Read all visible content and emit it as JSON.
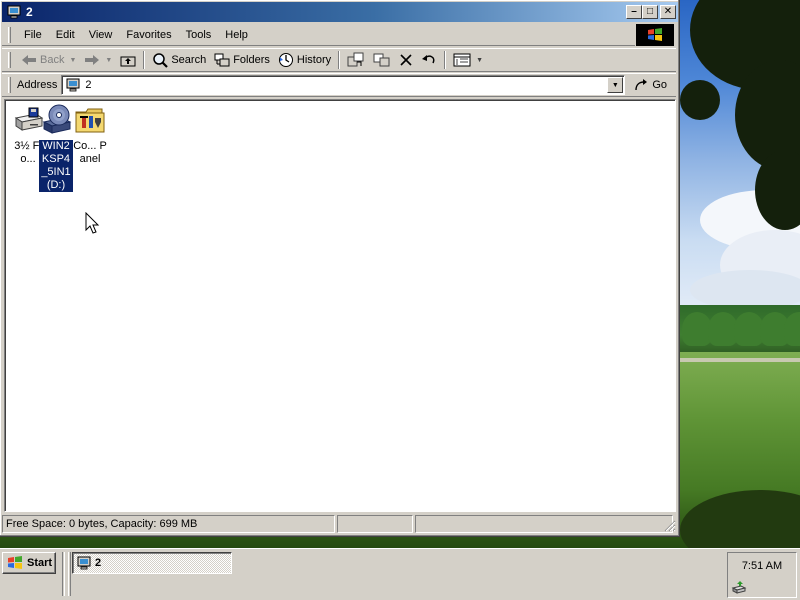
{
  "window": {
    "title": "2",
    "minimize_glyph": "–",
    "maximize_glyph": "□",
    "close_glyph": "✕"
  },
  "menubar": {
    "items": [
      {
        "label": "File"
      },
      {
        "label": "Edit"
      },
      {
        "label": "View"
      },
      {
        "label": "Favorites"
      },
      {
        "label": "Tools"
      },
      {
        "label": "Help"
      }
    ]
  },
  "toolbar": {
    "back_label": "Back",
    "search_label": "Search",
    "folders_label": "Folders",
    "history_label": "History"
  },
  "address": {
    "label": "Address",
    "value": "2",
    "go_label": "Go"
  },
  "files": [
    {
      "label": "3½ Flo...",
      "icon": "floppy-drive-icon",
      "selected": false
    },
    {
      "label": "WIN2KSP4_5IN1 (D:)",
      "icon": "cd-drive-icon",
      "selected": true
    },
    {
      "label": "Co... Panel",
      "icon": "control-panel-icon",
      "selected": false
    }
  ],
  "statusbar": {
    "text": "Free Space: 0 bytes, Capacity: 699 MB"
  },
  "taskbar": {
    "start_label": "Start",
    "task_label": "2",
    "clock": "7:51 AM"
  },
  "colors": {
    "titlebar_start": "#0a246a",
    "titlebar_end": "#a6caf0",
    "selection": "#0a246a",
    "chrome": "#d4d0c8"
  }
}
